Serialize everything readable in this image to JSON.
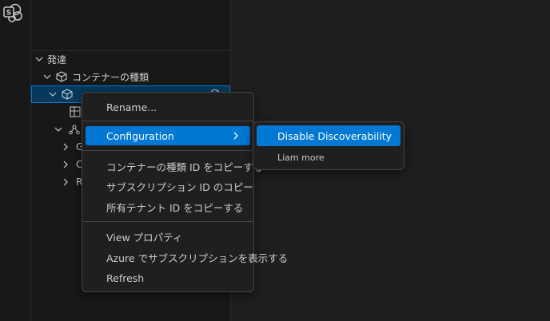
{
  "activity_bar": {
    "icons": [
      "sharepoint-embedded-icon"
    ]
  },
  "tree": {
    "root_label": "発達",
    "container_type_label": "コンテナーの種類",
    "items": [
      {
        "label": "G"
      },
      {
        "label": "C"
      },
      {
        "label": "R"
      }
    ]
  },
  "context_menu": {
    "rename": "Rename...",
    "configuration": "Configuration",
    "copy_container_type_id": "コンテナーの種類 ID をコピーする",
    "copy_subscription_id": "サブスクリプション ID のコピー",
    "copy_tenant_id": "所有テナント ID をコピーする",
    "view_properties": "View プロパティ",
    "view_subscription_azure": "Azure でサブスクリプションを表示する",
    "refresh": "Refresh"
  },
  "submenu": {
    "disable_discoverability": "Disable Discoverability",
    "learn_more": "Liam more"
  },
  "colors": {
    "accent": "#0078d4",
    "selection_bg": "#04395e",
    "menu_bg": "#1f1f1f",
    "menu_border": "#454545"
  }
}
